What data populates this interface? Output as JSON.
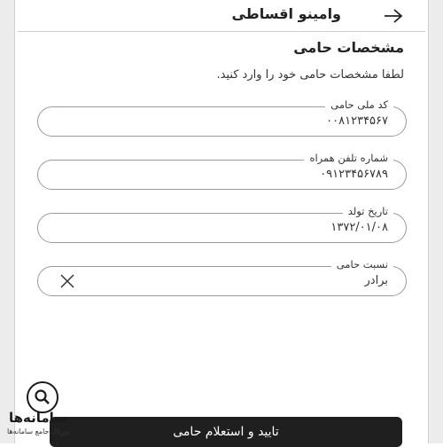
{
  "header": {
    "title": "وامینو اقساطی",
    "back_icon": "arrow-right-icon"
  },
  "section": {
    "title": "مشخصات حامی",
    "instructions": "لطفا مشخصات حامی خود را وارد کنید."
  },
  "fields": [
    {
      "label": "کد ملی حامی",
      "value": "۰۰۸۱۲۳۴۵۶۷"
    },
    {
      "label": "شماره تلفن همراه",
      "value": "۰۹۱۲۳۴۵۶۷۸۹"
    },
    {
      "label": "تاریخ تولد",
      "value": "۱۳۷۲/۰۱/۰۸"
    },
    {
      "label": "نسبت حامی",
      "value": "برادر",
      "clear_icon": "close-icon"
    }
  ],
  "confirm_button": {
    "label": "تایید و استعلام حامی"
  },
  "watermark": {
    "name": "سامانه‌ها",
    "subtitle": "پورتال جامع سامانه‌ها"
  }
}
